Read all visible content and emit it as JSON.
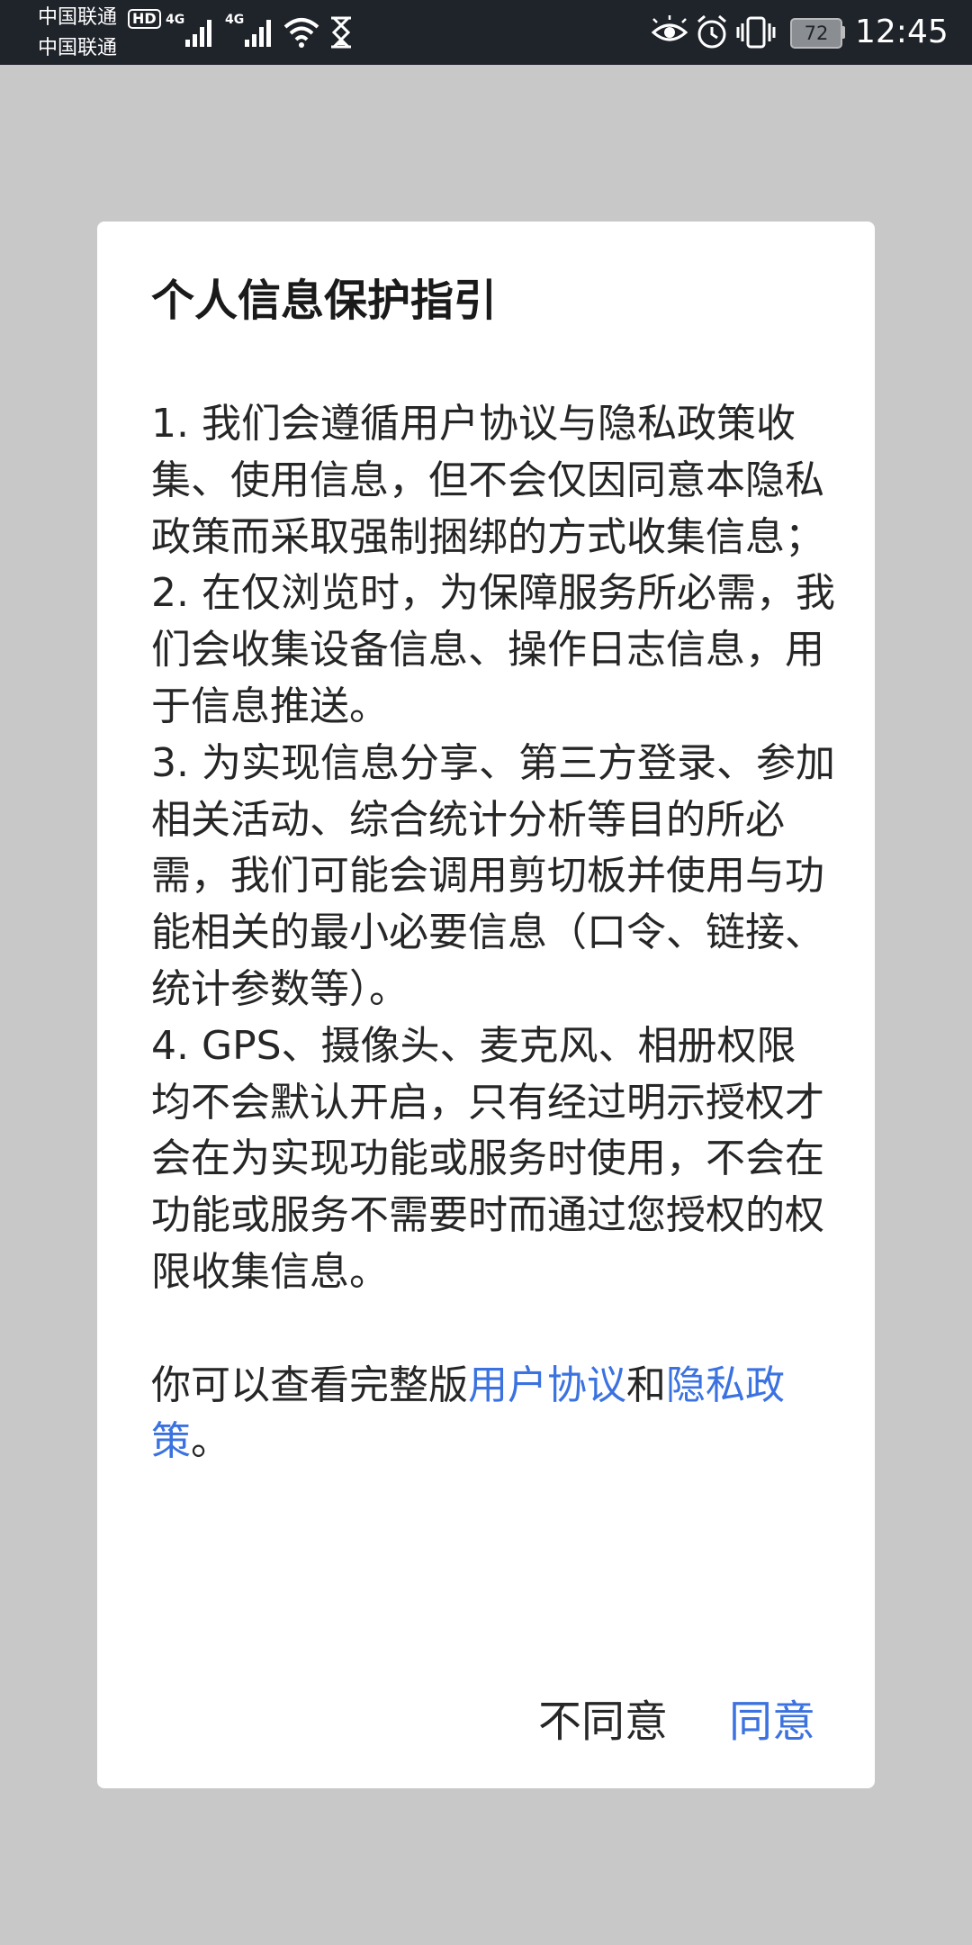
{
  "status_bar": {
    "carrier_1": "中国联通",
    "carrier_2": "中国联通",
    "hd_badge": "HD",
    "network_1": "4G",
    "network_2": "4G",
    "battery_level": "72",
    "time": "12:45",
    "icons": [
      "signal-icon",
      "signal-icon",
      "wifi-icon",
      "hourglass-icon",
      "eye-icon",
      "alarm-icon",
      "vibrate-icon",
      "battery-icon"
    ]
  },
  "dialog": {
    "title": "个人信息保护指引",
    "body": {
      "item_1": "1. 我们会遵循用户协议与隐私政策收集、使用信息，但不会仅因同意本隐私政策而采取强制捆绑的方式收集信息；",
      "item_2": " 2. 在仅浏览时，为保障服务所必需，我们会收集设备信息、操作日志信息，用于信息推送。",
      "item_3": " 3. 为实现信息分享、第三方登录、参加相关活动、综合统计分析等目的所必需，我们可能会调用剪切板并使用与功能相关的最小必要信息（口令、链接、统计参数等）。",
      "item_4": " 4. GPS、摄像头、麦克风、相册权限均不会默认开启，只有经过明示授权才会在为实现功能或服务时使用，不会在功能或服务不需要时而通过您授权的权限收集信息。",
      "links_prefix": " 你可以查看完整版",
      "user_agreement_link": "用户协议",
      "links_and": "和",
      "privacy_policy_link": "隐私政策",
      "links_suffix": "。"
    },
    "disagree_label": "不同意",
    "agree_label": "同意",
    "link_color": "#3b72e0"
  }
}
